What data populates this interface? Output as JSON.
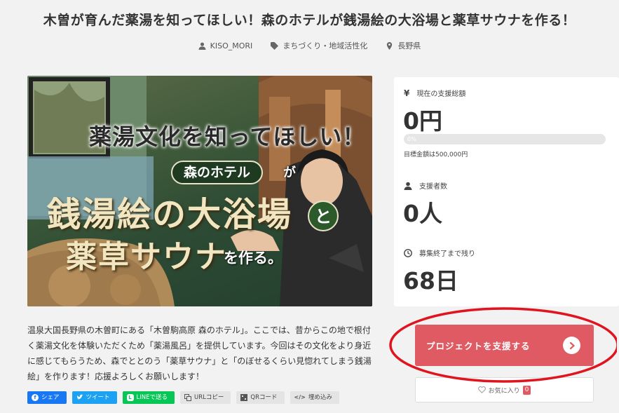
{
  "project": {
    "title": "木曽が育んだ薬湯を知ってほしい！森のホテルが銭湯絵の大浴場と薬草サウナを作る！",
    "author": "KISO_MORI",
    "category": "まちづくり・地域活性化",
    "location": "長野県"
  },
  "hero": {
    "line1": "薬湯文化を知ってほしい！",
    "badge": "森のホテル",
    "particle_ga": "が",
    "line3": "銭湯絵の大浴場",
    "particle_to": "と",
    "line4": "薬草サウナ",
    "line5": "を作る。"
  },
  "description": "温泉大国長野県の木曽町にある「木曽駒高原 森のホテル」。ここでは、昔からこの地で根付く薬湯文化を体験いただくため「薬湯風呂」を提供しています。今回はその文化をより身近に感じてもらうため、森でととのう「薬草サウナ」と「のぼせるくらい見惚れてしまう銭湯絵」を作ります！応援よろしくお願いします！",
  "share": {
    "facebook": "シェア",
    "twitter": "ツイート",
    "line": "LINEで送る",
    "url_copy": "URLコピー",
    "qr": "QRコード",
    "embed": "埋め込み"
  },
  "stats": {
    "total_label": "現在の支援総額",
    "total_value": "0円",
    "progress_text": "0%",
    "progress_percent": 0,
    "goal_text": "目標金額は500,000円",
    "backers_label": "支援者数",
    "backers_value": "0人",
    "remaining_label": "募集終了まで残り",
    "remaining_value": "68日"
  },
  "actions": {
    "support_label": "プロジェクトを支援する",
    "favorite_label": "お気に入り",
    "favorite_count": "0"
  },
  "colors": {
    "accent": "#e05a63",
    "annotation": "#e0141e"
  }
}
